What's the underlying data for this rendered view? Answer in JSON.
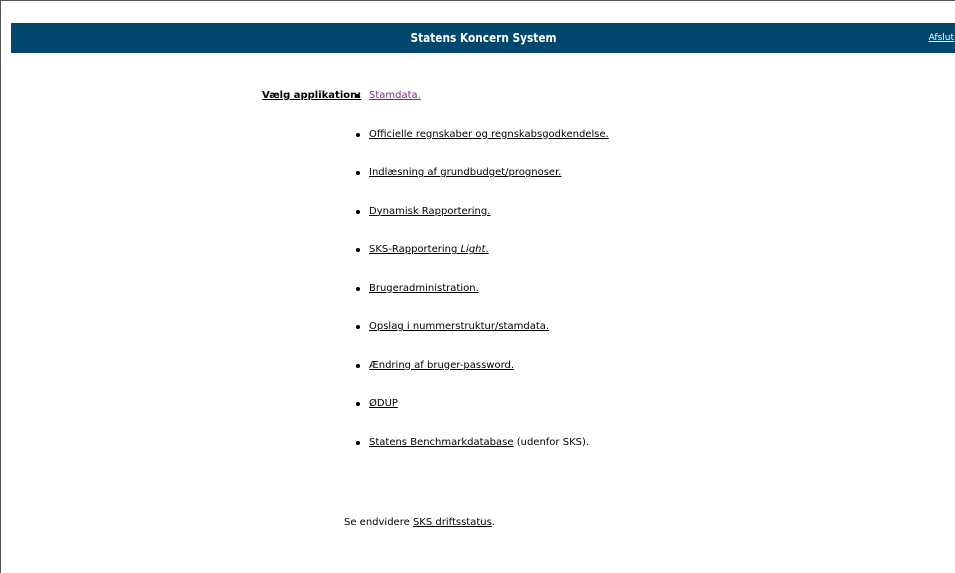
{
  "header": {
    "title": "Statens Koncern System",
    "exit_label": "Afslut"
  },
  "menu": {
    "label": "Vælg applikation:",
    "items": [
      {
        "label": "Stamdata.",
        "visited": true
      },
      {
        "label": "Officielle regnskaber og regnskabsgodkendelse."
      },
      {
        "label": "Indlæsning af grundbudget/prognoser."
      },
      {
        "label": "Dynamisk Rapportering."
      },
      {
        "label": "SKS-Rapportering ",
        "emphasis": "Light",
        "suffix": "."
      },
      {
        "label": "Brugeradministration."
      },
      {
        "label": "Opslag i nummerstruktur/stamdata."
      },
      {
        "label": "Ændring af bruger-password."
      },
      {
        "label": "ØDUP"
      },
      {
        "label": "Statens Benchmarkdatabase",
        "note": " (udenfor SKS)."
      }
    ]
  },
  "footer": {
    "prefix": "Se endvidere ",
    "link": "SKS driftsstatus",
    "suffix": "."
  },
  "colors": {
    "header_bg": "#00486e",
    "visited_link": "#7a2480"
  }
}
